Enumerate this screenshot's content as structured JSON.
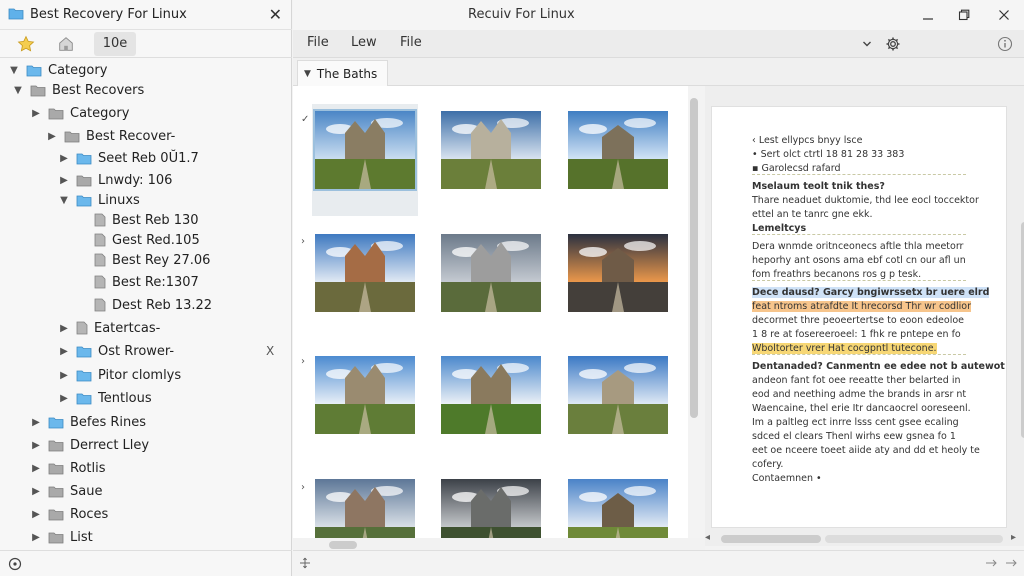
{
  "left_panel": {
    "title": "Best Recovery For Linux",
    "tabs": {
      "active_label": "10e"
    },
    "tree": [
      {
        "label": "Category",
        "depth": 0,
        "expanded": true,
        "icon": "folder-blue"
      },
      {
        "label": "Best Recovers",
        "depth": 1,
        "expanded": true,
        "icon": "folder-gray"
      },
      {
        "label": "Category",
        "depth": 2,
        "expanded": false,
        "icon": "folder-gray"
      },
      {
        "label": "Best Recover-",
        "depth": 3,
        "expanded": false,
        "icon": "folder-gray"
      },
      {
        "label": "Seet Reb 0Ŭ1.7",
        "depth": 4,
        "expanded": false,
        "icon": "folder-blue"
      },
      {
        "label": "Lnwdy: 106",
        "depth": 4,
        "expanded": false,
        "icon": "folder-gray"
      },
      {
        "label": "Linuxs",
        "depth": 4,
        "expanded": true,
        "icon": "folder-blue"
      },
      {
        "label": "Best Reb 130",
        "depth": 5,
        "icon": "file"
      },
      {
        "label": "Gest Red.105",
        "depth": 5,
        "icon": "file"
      },
      {
        "label": "Best Rey 27.06",
        "depth": 5,
        "icon": "file"
      },
      {
        "label": "Best Re:1307",
        "depth": 5,
        "icon": "file"
      },
      {
        "label": "Dest Reb 13.22",
        "depth": 5,
        "icon": "file"
      },
      {
        "label": "Eatertcas-",
        "depth": 4,
        "expanded": false,
        "icon": "file"
      },
      {
        "label": "Ost Rrower-",
        "depth": 4,
        "expanded": false,
        "icon": "folder-blue",
        "close": "X"
      },
      {
        "label": "Pitor clomlys",
        "depth": 4,
        "expanded": false,
        "icon": "folder-blue"
      },
      {
        "label": "Tentlous",
        "depth": 4,
        "expanded": false,
        "icon": "folder-blue"
      },
      {
        "label": "Befes Rines",
        "depth": 2,
        "expanded": false,
        "icon": "folder-blue"
      },
      {
        "label": "Derrect Lley",
        "depth": 2,
        "expanded": false,
        "icon": "folder-gray"
      },
      {
        "label": "Rotlis",
        "depth": 2,
        "expanded": false,
        "icon": "folder-gray"
      },
      {
        "label": "Saue",
        "depth": 2,
        "expanded": false,
        "icon": "folder-gray"
      },
      {
        "label": "Roces",
        "depth": 2,
        "expanded": false,
        "icon": "folder-gray"
      },
      {
        "label": "List",
        "depth": 2,
        "expanded": false,
        "icon": "folder-gray"
      }
    ]
  },
  "window": {
    "title": "Recuiv For Linux"
  },
  "toolbar": {
    "menu": [
      "File",
      "Lew",
      "File"
    ]
  },
  "tab": {
    "label": "The Baths"
  },
  "thumbnails": [
    {
      "scene": "church-field-1"
    },
    {
      "scene": "cathedral-road"
    },
    {
      "scene": "church-field-2"
    },
    {
      "scene": "brick-manor"
    },
    {
      "scene": "gray-cathedral"
    },
    {
      "scene": "sunset-corridor"
    },
    {
      "scene": "chapel-path"
    },
    {
      "scene": "tree-road"
    },
    {
      "scene": "plain-road"
    },
    {
      "scene": "old-house"
    },
    {
      "scene": "dark-field"
    },
    {
      "scene": "farm-sky"
    }
  ],
  "document": {
    "lines": [
      {
        "text": "‹  Lest ellypcs bnyy lsce",
        "style": ""
      },
      {
        "text": "•  Sert olct ctrtl 18 81 28 33 383",
        "style": ""
      },
      {
        "text": "▪  Garolecsd rafard",
        "style": ""
      },
      {
        "sep": true
      },
      {
        "text": "Mselaum teolt tnik thes?",
        "style": "h"
      },
      {
        "text": "Thare neaduet duktomie, thd lee eocl toccektor",
        "style": ""
      },
      {
        "text": "ettel an te tanrc gne ekk.",
        "style": ""
      },
      {
        "text": "Lemeltcys",
        "style": "h"
      },
      {
        "sep": true
      },
      {
        "text": "Dera wnmde oritnceonecs aftle thla meetorr",
        "style": ""
      },
      {
        "text": "heporhy ant osons ama ebf cotl cn our afl un",
        "style": ""
      },
      {
        "text": "fom freathrs becanons ros g p tesk.",
        "style": ""
      },
      {
        "sep": true
      },
      {
        "text": "Dece dausd? Garcy bngiwrssetx br uere elrd",
        "style": "h",
        "hl": "b"
      },
      {
        "text": "feat ntroms  atrafdte It hrecorsd Thr wr codlior",
        "style": "",
        "hl": "o"
      },
      {
        "text": "decormet thre peoeertertse to eoon edeoloe",
        "style": ""
      },
      {
        "text": "1 8 re at fosereeroeel: 1 fhk re pntepe en fo",
        "style": ""
      },
      {
        "text": "Wboltorter vrer Hat cocgpntl tutecone.",
        "style": "",
        "hl": "y"
      },
      {
        "sep": true
      },
      {
        "text": "Dentanaded? Canmentn ee edee not b autewot",
        "style": "h"
      },
      {
        "text": "andeon fant fot oee reeatte ther belarted in",
        "style": ""
      },
      {
        "text": "eod and neething adme the brands in arsr nt",
        "style": ""
      },
      {
        "text": "Waencaine, thel erie Itr  dancaocrel ooreseenl.",
        "style": ""
      },
      {
        "text": "Im a paltleg ect inrre lsss cent gsee ecaling",
        "style": ""
      },
      {
        "text": "sdced el clears  Thenl wirhs eew gsnea fo 1",
        "style": ""
      },
      {
        "text": "eet oe nceere toeet aiide aty and dd et heoly te",
        "style": ""
      },
      {
        "text": "cofery.",
        "style": ""
      },
      {
        "text": "Contaemnen •",
        "style": ""
      }
    ]
  },
  "colors": {
    "accent": "#4aa3df",
    "selection": "#9cc0dd",
    "highlight_orange": "#f7c58c",
    "highlight_yellow": "#f7d775",
    "highlight_blue": "#cfe2f7"
  }
}
